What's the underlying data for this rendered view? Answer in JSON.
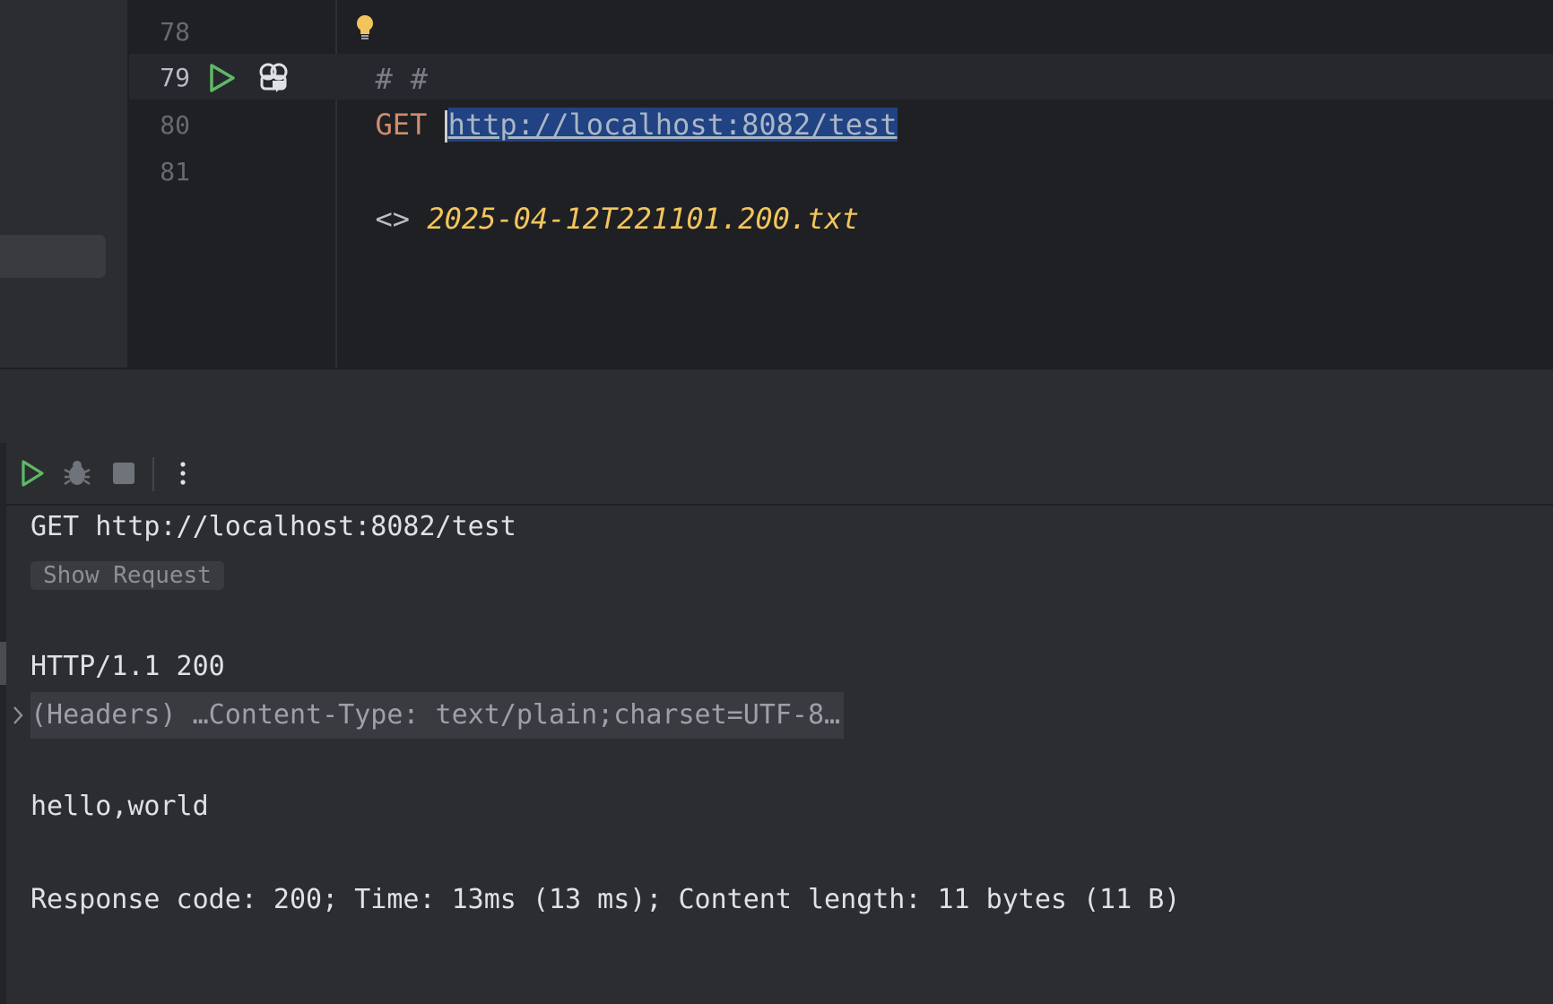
{
  "editor": {
    "lines": [
      {
        "number": "78",
        "hash_left": "#",
        "hash_right": "#"
      },
      {
        "number": "79",
        "method": "GET",
        "url": "http://localhost:8082/test"
      },
      {
        "number": "80"
      },
      {
        "number": "81",
        "redirect_symbol": "<>",
        "redirect_file": "2025-04-12T221101.200.txt"
      }
    ],
    "icons": {
      "bulb": "lightbulb-icon",
      "run": "run-icon",
      "ai": "ai-assistant-icon"
    }
  },
  "toolbar": {
    "icons": [
      "rerun-icon",
      "debug-icon",
      "stop-icon",
      "more-vertical-icon"
    ]
  },
  "output": {
    "request": "GET http://localhost:8082/test",
    "show_request": "Show Request",
    "status": "HTTP/1.1 200",
    "headers_summary": "(Headers) …Content-Type: text/plain;charset=UTF-8…",
    "body": "hello,world",
    "summary": "Response code: 200; Time: 13ms (13 ms); Content length: 11 bytes (11 B)"
  },
  "colors": {
    "method": "#cf8e6d",
    "selection": "#214283",
    "redirect_file": "#f2c55c",
    "run_green": "#5fb865"
  }
}
